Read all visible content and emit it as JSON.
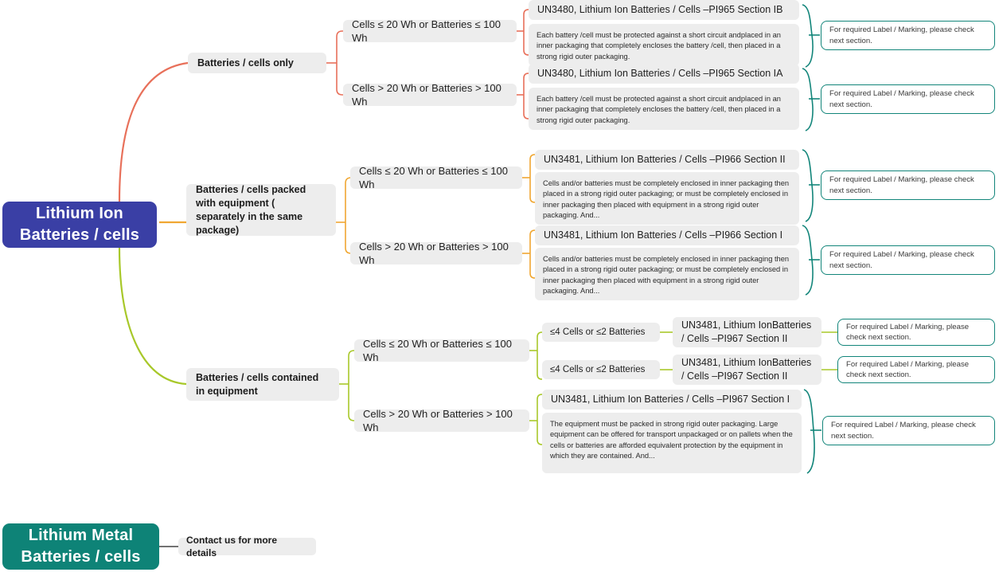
{
  "diagram": {
    "title": "Lithium Battery Shipping Classification Mind Map",
    "colors": {
      "root_blue": "#3a3fa5",
      "root_teal": "#0e8377",
      "branch1": "#e8705a",
      "branch2": "#f0a732",
      "branch3": "#a8c82a",
      "note_border": "#12857a",
      "pill_bg": "#ededed",
      "connector_gray": "#444444"
    }
  },
  "roots": {
    "lithium_ion": "Lithium Ion Batteries / cells",
    "lithium_metal": "Lithium Metal Batteries / cells",
    "lithium_metal_note": "Contact us for more details"
  },
  "note_text": "For required Label / Marking, please check next section.",
  "branches": [
    {
      "id": "batteries-cells-only",
      "label": "Batteries / cells only",
      "conditions": [
        {
          "id": "cond-le20",
          "label": "Cells ≤ 20 Wh or Batteries ≤ 100 Wh",
          "title": "UN3480, Lithium Ion Batteries / Cells –PI965 Section IB",
          "body": "Each battery /cell must be protected against a short circuit andplaced in an inner packaging that completely encloses the battery /cell, then placed in a strong rigid outer packaging.",
          "note": "For required Label / Marking, please check next section."
        },
        {
          "id": "cond-gt20",
          "label": "Cells > 20 Wh or Batteries > 100 Wh",
          "title": "UN3480, Lithium Ion Batteries / Cells –PI965 Section IA",
          "body": "Each battery /cell must be protected against a short circuit andplaced in an inner packaging that completely encloses the battery /cell, then placed in a strong rigid outer packaging.",
          "note": "For required Label / Marking, please check next section."
        }
      ]
    },
    {
      "id": "packed-with-equipment",
      "label": "Batteries / cells packed with equipment ( separately in the same package)",
      "conditions": [
        {
          "id": "cond-le20",
          "label": "Cells ≤ 20 Wh or Batteries ≤ 100 Wh",
          "title": "UN3481, Lithium Ion Batteries / Cells –PI966 Section II",
          "body": "Cells and/or batteries must be completely enclosed in inner packaging then placed in a strong rigid outer packaging; or must be completely enclosed in inner packaging then placed with equipment in a strong rigid outer packaging. And...",
          "note": "For required Label / Marking, please check next section."
        },
        {
          "id": "cond-gt20",
          "label": "Cells > 20 Wh or Batteries > 100 Wh",
          "title": "UN3481, Lithium Ion Batteries / Cells –PI966 Section I",
          "body": "Cells and/or batteries must be completely enclosed in inner packaging then placed in a strong rigid outer packaging; or must be completely enclosed in inner packaging then placed with equipment in a strong rigid outer packaging. And...",
          "note": "For required Label / Marking, please check next section."
        }
      ]
    },
    {
      "id": "contained-in-equipment",
      "label": "Batteries / cells contained in equipment",
      "conditions": [
        {
          "id": "cond-le20",
          "label": "Cells ≤ 20 Wh or Batteries ≤ 100 Wh",
          "subitems": [
            {
              "label": "≤4 Cells or ≤2 Batteries",
              "title": "UN3481, Lithium IonBatteries / Cells –PI967 Section II",
              "note": "For required Label / Marking, please check next section."
            },
            {
              "label": "≤4 Cells or ≤2 Batteries",
              "title": "UN3481, Lithium IonBatteries / Cells –PI967 Section II",
              "note": "For required Label / Marking, please check next section."
            }
          ]
        },
        {
          "id": "cond-gt20",
          "label": "Cells > 20 Wh or Batteries > 100 Wh",
          "title": "UN3481, Lithium Ion Batteries / Cells –PI967 Section I",
          "body": "The equipment must be packed in strong rigid outer packaging. Large equipment can be offered for transport unpackaged or on pallets when the cells or batteries are afforded equivalent protection by the equipment in which they are contained. And...",
          "note": "For required Label / Marking, please check next section."
        }
      ]
    }
  ]
}
